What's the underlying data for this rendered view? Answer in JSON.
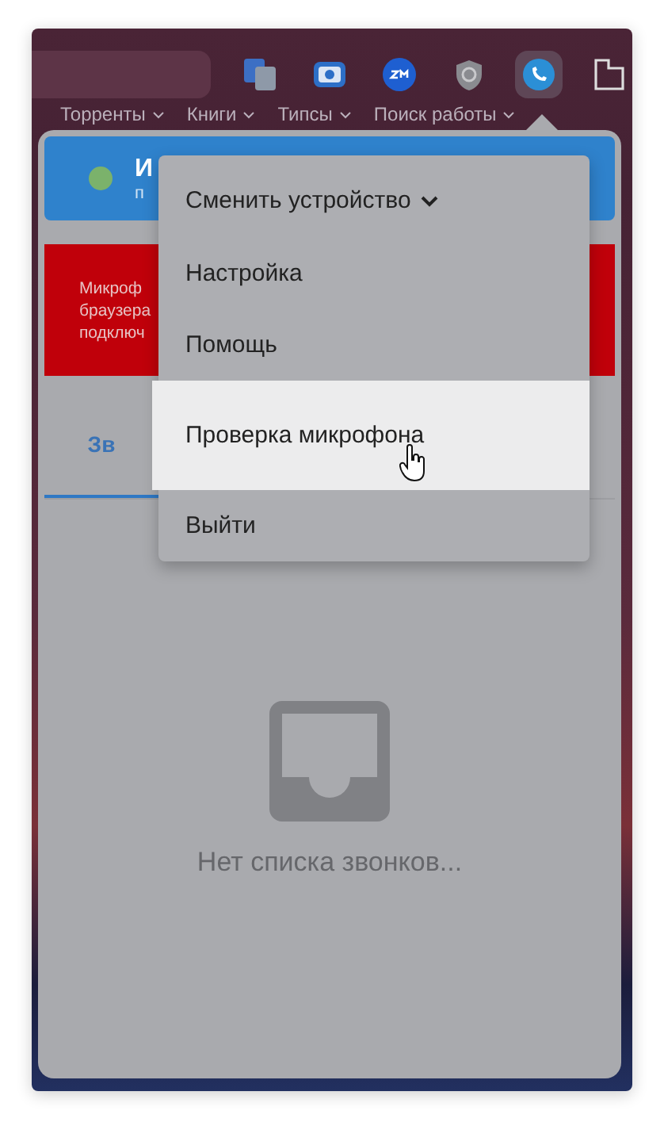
{
  "bookmarks": [
    {
      "label": "Торренты"
    },
    {
      "label": "Книги"
    },
    {
      "label": "Типсы"
    },
    {
      "label": "Поиск работы"
    }
  ],
  "popup": {
    "header": {
      "title": "И",
      "subtitle": "п",
      "online": true
    },
    "alert": {
      "lines": [
        "Микроф",
        "браузера",
        "подключ"
      ]
    },
    "tabs": [
      {
        "label": "Зв",
        "selected": true
      }
    ],
    "empty_state": {
      "text": "Нет списка звонков..."
    }
  },
  "menu": {
    "items": [
      {
        "label": "Сменить устройство",
        "kind": "submenu",
        "hovered": false
      },
      {
        "label": "Настройка",
        "kind": "item",
        "hovered": false
      },
      {
        "label": "Помощь",
        "kind": "item",
        "hovered": false
      },
      {
        "label": "Проверка микрофона",
        "kind": "item",
        "hovered": true
      },
      {
        "label": "Выйти",
        "kind": "item",
        "hovered": false
      }
    ]
  }
}
